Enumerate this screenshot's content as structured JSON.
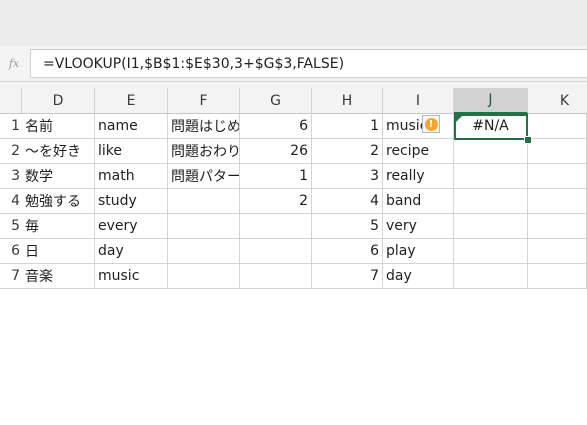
{
  "formula_bar": {
    "fx_label": "fx",
    "formula": "=VLOOKUP(I1,$B$1:$E$30,3+$G$3,FALSE)"
  },
  "columns": [
    "D",
    "E",
    "F",
    "G",
    "H",
    "I",
    "J",
    "K"
  ],
  "active_column": "J",
  "rows": [
    {
      "num": "1",
      "D": "名前",
      "E": "name",
      "F": "問題はじめ",
      "G": "6",
      "H": "1",
      "I": "music",
      "J": "#N/A"
    },
    {
      "num": "2",
      "D": "〜を好き",
      "E": "like",
      "F": "問題おわり",
      "G": "26",
      "H": "2",
      "I": "recipe",
      "J": ""
    },
    {
      "num": "3",
      "D": "数学",
      "E": "math",
      "F": "問題パター",
      "G": "1",
      "H": "3",
      "I": "really",
      "J": ""
    },
    {
      "num": "4",
      "D": "勉強する",
      "E": "study",
      "F": "",
      "G": "2",
      "H": "4",
      "I": "band",
      "J": ""
    },
    {
      "num": "5",
      "D": "毎",
      "E": "every",
      "F": "",
      "G": "",
      "H": "5",
      "I": "very",
      "J": ""
    },
    {
      "num": "6",
      "D": "日",
      "E": "day",
      "F": "",
      "G": "",
      "H": "6",
      "I": "play",
      "J": ""
    },
    {
      "num": "7",
      "D": "音楽",
      "E": "music",
      "F": "",
      "G": "",
      "H": "7",
      "I": "day",
      "J": ""
    }
  ],
  "selected_cell": "J1",
  "error_indicator_icon": "warning-icon",
  "colors": {
    "accent_green": "#217346",
    "warning_orange": "#f0a830"
  }
}
